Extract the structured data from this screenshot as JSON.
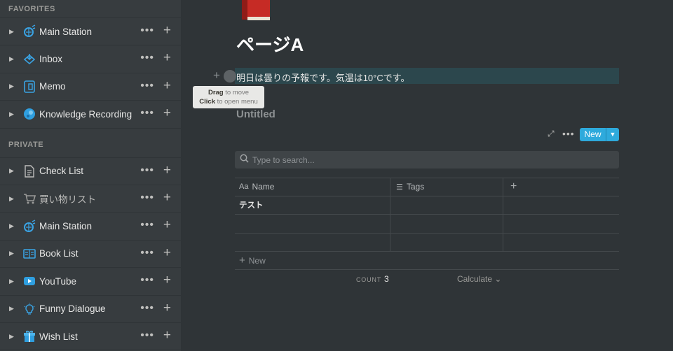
{
  "sidebar": {
    "favorites_label": "FAVORITES",
    "private_label": "PRIVATE",
    "favorites": [
      {
        "label": "Main Station",
        "icon": "globe-satellite-icon"
      },
      {
        "label": "Inbox",
        "icon": "inbox-tray-icon"
      },
      {
        "label": "Memo",
        "icon": "memo-icon"
      },
      {
        "label": "Knowledge Recording",
        "icon": "record-disc-icon"
      }
    ],
    "private": [
      {
        "label": "Check List",
        "icon": "document-icon"
      },
      {
        "label": "買い物リスト",
        "icon": "shopping-cart-icon"
      },
      {
        "label": "Main Station",
        "icon": "globe-satellite-icon"
      },
      {
        "label": "Book List",
        "icon": "open-book-icon"
      },
      {
        "label": "YouTube",
        "icon": "youtube-icon"
      },
      {
        "label": "Funny Dialogue",
        "icon": "lightbulb-icon"
      },
      {
        "label": "Wish List",
        "icon": "gift-icon"
      }
    ],
    "more_glyph": "•••",
    "add_glyph": "+"
  },
  "page": {
    "icon": "red-book-icon",
    "title": "ページA",
    "block_text": "明日は曇りの予報です。気温は10°Cです。",
    "tooltip": {
      "drag": "Drag",
      "drag_rest": " to move",
      "click": "Click",
      "click_rest": " to open menu"
    }
  },
  "database": {
    "title": "Untitled",
    "new_label": "New",
    "search_placeholder": "Type to search...",
    "columns": [
      "Name",
      "Tags"
    ],
    "rows": [
      {
        "name": "テスト",
        "tags": ""
      },
      {
        "name": "",
        "tags": ""
      },
      {
        "name": "",
        "tags": ""
      }
    ],
    "new_row_label": "New",
    "count_label": "COUNT",
    "count_value": "3",
    "calculate_label": "Calculate"
  },
  "colors": {
    "accent": "#2eaadc",
    "background": "#2f3437",
    "sidebar": "#373c3f",
    "highlight": "#2c474d"
  }
}
